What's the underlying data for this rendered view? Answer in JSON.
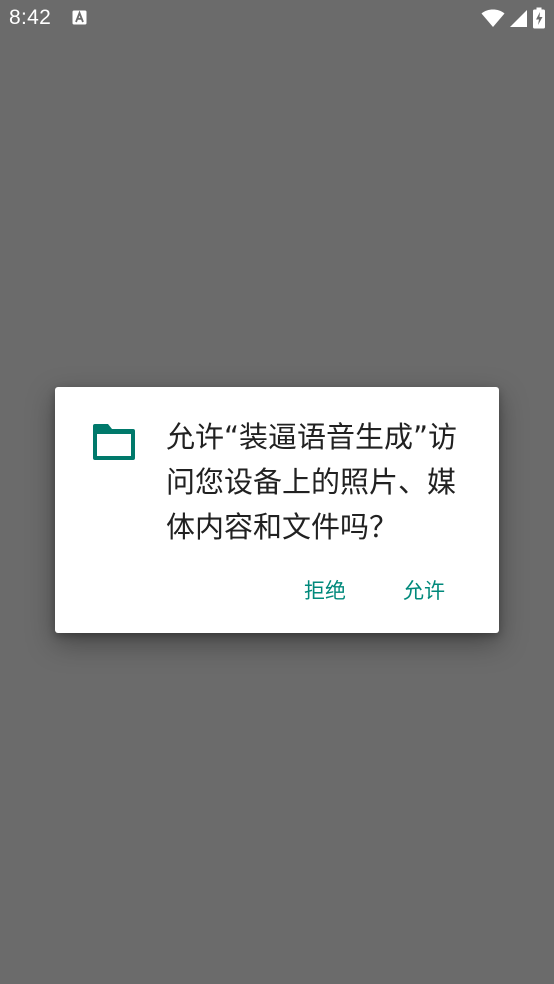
{
  "status_bar": {
    "time": "8:42",
    "notification_icon": "text-a-notification-icon",
    "icons": [
      "wifi-icon",
      "cell-signal-icon",
      "battery-charging-icon"
    ]
  },
  "dialog": {
    "icon": "folder-icon",
    "message": "允许“装逼语音生成”访问您设备上的照片、媒体内容和文件吗？",
    "deny_label": "拒绝",
    "allow_label": "允许"
  },
  "colors": {
    "scrim": "#6b6b6b",
    "dialog_bg": "#ffffff",
    "accent": "#00897b",
    "icon": "#00796b",
    "text": "#212121"
  }
}
